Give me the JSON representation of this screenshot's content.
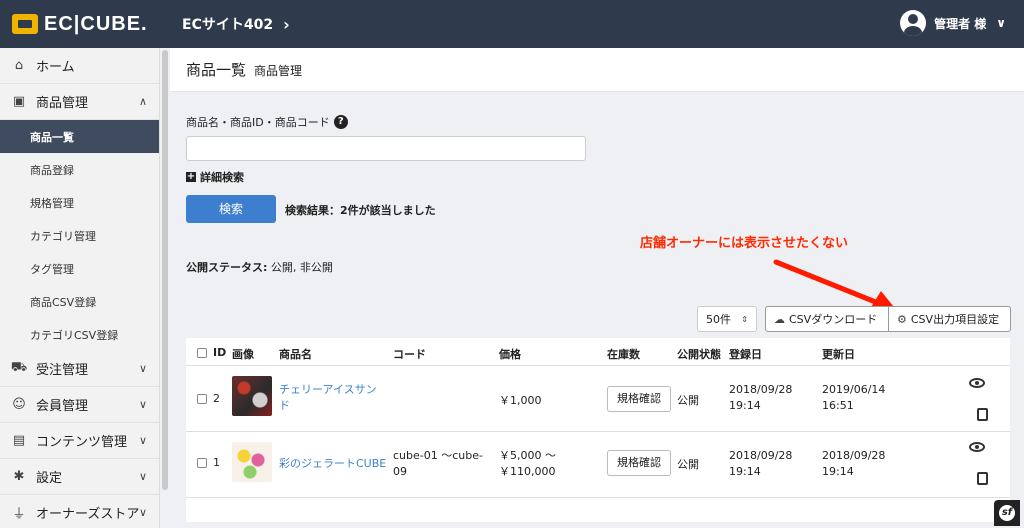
{
  "header": {
    "logo_text": "EC|CUBE.",
    "site_name": "ECサイト402",
    "site_chevron": "›",
    "user_label": "管理者 様",
    "user_chevron": "∨"
  },
  "sidebar": {
    "items": [
      {
        "label": "ホーム",
        "icon": "home-icon",
        "glyph": "⌂"
      },
      {
        "label": "商品管理",
        "icon": "box-icon",
        "glyph": "▣",
        "chevron": "∧"
      },
      {
        "label": "受注管理",
        "icon": "cart-icon",
        "glyph": "⛟",
        "chevron": "∨"
      },
      {
        "label": "会員管理",
        "icon": "users-icon",
        "glyph": "☺",
        "chevron": "∨"
      },
      {
        "label": "コンテンツ管理",
        "icon": "file-icon",
        "glyph": "▤",
        "chevron": "∨"
      },
      {
        "label": "設定",
        "icon": "gear-icon",
        "glyph": "✱",
        "chevron": "∨"
      },
      {
        "label": "オーナーズストア",
        "icon": "plug-icon",
        "glyph": "⏚",
        "chevron": "∨"
      }
    ],
    "sub_items": [
      "商品一覧",
      "商品登録",
      "規格管理",
      "カテゴリ管理",
      "タグ管理",
      "商品CSV登録",
      "カテゴリCSV登録"
    ]
  },
  "page": {
    "title": "商品一覧",
    "subtitle": "商品管理"
  },
  "search": {
    "label": "商品名・商品ID・商品コード",
    "help": "?",
    "input_value": "",
    "advanced_label": "詳細検索",
    "advanced_plus": "+",
    "button_label": "検索",
    "result_text": "検索結果：2件が該当しました",
    "status_label": "公開ステータス:",
    "status_value": "公開, 非公開"
  },
  "annotation": "店舗オーナーには表示させたくない",
  "toolbar": {
    "per_page": "50件",
    "per_page_arrow": "⇕",
    "csv_download": "CSVダウンロード",
    "csv_settings": "CSV出力項目設定"
  },
  "table": {
    "headers": [
      "ID",
      "画像",
      "商品名",
      "コード",
      "価格",
      "在庫数",
      "公開状態",
      "登録日",
      "更新日"
    ],
    "rows": [
      {
        "id": "2",
        "name_line1": "チェリーアイスサン",
        "name_line2": "ド",
        "code_line1": "",
        "code_line2": "",
        "price_line1": "￥1,000",
        "price_line2": "",
        "stock_button": "規格確認",
        "status": "公開",
        "created_date": "2018/09/28",
        "created_time": "19:14",
        "updated_date": "2019/06/14",
        "updated_time": "16:51"
      },
      {
        "id": "1",
        "name_line1": "彩のジェラートCUBE",
        "name_line2": "",
        "code_line1": "cube-01 〜cube-",
        "code_line2": "09",
        "price_line1": "￥5,000 〜",
        "price_line2": "￥110,000",
        "stock_button": "規格確認",
        "status": "公開",
        "created_date": "2018/09/28",
        "created_time": "19:14",
        "updated_date": "2018/09/28",
        "updated_time": "19:14"
      }
    ]
  },
  "colors": {
    "header_bg": "#2f3b4c",
    "primary": "#3d7fce",
    "annotation": "#ff2a00",
    "active_nav": "#3f4b5e"
  }
}
